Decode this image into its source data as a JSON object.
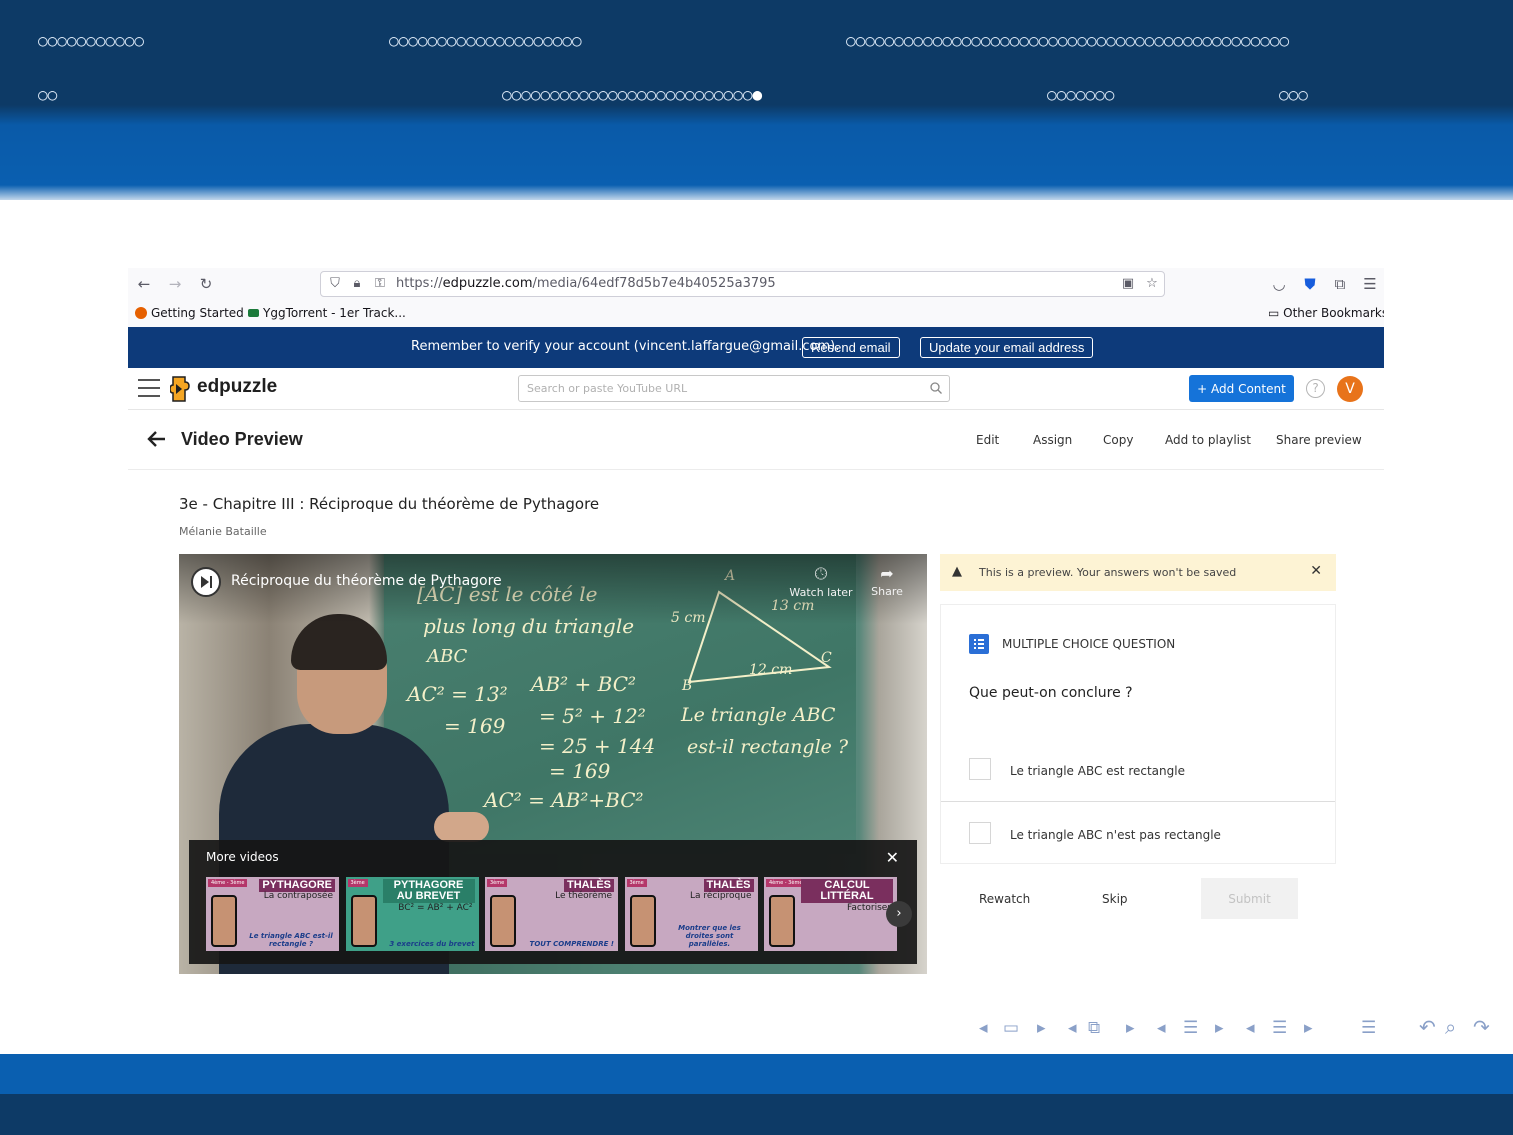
{
  "beamer": {
    "nav_row1": [
      {
        "dots": "○○○○○○○○○○○"
      },
      {
        "dots": "○○○○○○○○○○○○○○○○○○○○"
      },
      {
        "dots": "○○○○○○○○○○○○○○○○○○○○○○○○○○○○○○○○○○○○○○○○○○○○○○"
      }
    ],
    "nav_row2": [
      {
        "dots": "○○"
      },
      {
        "dots": "○○○○○○○○○○○○○○○○○○○○○○○○○○",
        "current": "●"
      },
      {
        "dots": "○○○○○○○"
      },
      {
        "dots": "○○○"
      }
    ],
    "footer_nav": {
      "frame_left": "◂",
      "frame_icon": "▭",
      "frame_right": "▸",
      "subsection_left": "◂",
      "subsection_icon": "⧉",
      "subsection_right": "▸",
      "section_left": "◂",
      "section_icon": "☰",
      "section_right": "▸",
      "doc_left": "◂",
      "doc_icon": "☰",
      "doc_right": "▸",
      "toc_icon": "☰",
      "back_icon": "↶",
      "search_icon": "⌕",
      "forward_icon": "↷"
    }
  },
  "browser": {
    "url_scheme": "https://",
    "url_host": "edpuzzle.com",
    "url_path": "/media/64edf78d5b7e4b40525a3795",
    "bookmarks": [
      "Getting Started",
      "YggTorrent - 1er Track..."
    ],
    "other_bookmarks": "Other Bookmarks",
    "colors": {
      "firefox": "#e66000",
      "ygg": "#1b7a3a"
    }
  },
  "banner": {
    "text": "Remember to verify your account (vincent.laffargue@gmail.com).",
    "resend": "Resend email",
    "update": "Update your email address"
  },
  "app": {
    "logo_text": "edpuzzle",
    "search_placeholder": "Search or paste YouTube URL",
    "add_content": "+ Add Content",
    "help": "?",
    "avatar": "V",
    "accent": "#1573d9"
  },
  "subheader": {
    "title": "Video Preview",
    "actions": [
      "Edit",
      "Assign",
      "Copy",
      "Add to playlist",
      "Share preview"
    ]
  },
  "video": {
    "title": "3e - Chapitre III : Réciproque du théorème de Pythagore",
    "author": "Mélanie Bataille",
    "yt_title": "Réciproque du théorème de Pythagore",
    "watch_later": "Watch later",
    "share": "Share",
    "more_videos": "More videos",
    "thumbnails": [
      {
        "badge": "4ème - 3ème",
        "title": "PYTHAGORE",
        "sub": "La contraposée",
        "foot": "Le triangle ABC est-il rectangle ?",
        "bg": "#c7a8c1",
        "title_bg": "#7a2f5e"
      },
      {
        "badge": "3ème",
        "title": "PYTHAGORE AU BREVET",
        "sub": "BC² = AB² + AC²",
        "foot": "3 exercices du brevet",
        "bg": "#3fa088",
        "title_bg": "#2a7f68"
      },
      {
        "badge": "3ème",
        "title": "THALÈS",
        "sub": "Le théorème",
        "foot": "TOUT COMPRENDRE !",
        "bg": "#c7a8c1",
        "title_bg": "#7a2f5e"
      },
      {
        "badge": "3ème",
        "title": "THALÈS",
        "sub": "La réciproque",
        "foot": "Montrer que les droites sont parallèles.",
        "bg": "#c7a8c1",
        "title_bg": "#7a2f5e"
      },
      {
        "badge": "4ème - 3ème",
        "title": "CALCUL LITTÉRAL",
        "sub": "Factoriser",
        "foot": "",
        "bg": "#c7a8c1",
        "title_bg": "#7a2f5e"
      }
    ]
  },
  "question": {
    "alert": "This is a preview. Your answers won't be saved",
    "type": "MULTIPLE CHOICE QUESTION",
    "text": "Que peut-on conclure ?",
    "options": [
      "Le triangle ABC est rectangle",
      "Le triangle ABC n'est pas rectangle"
    ],
    "rewatch": "Rewatch",
    "skip": "Skip",
    "submit": "Submit"
  }
}
